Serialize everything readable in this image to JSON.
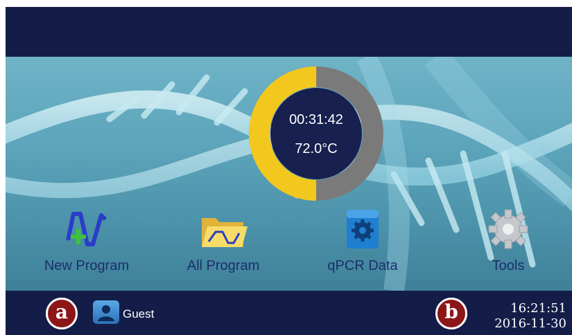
{
  "status": {
    "timer": "00:31:42",
    "temperature": "72.0°C",
    "progress_fraction": 0.5,
    "progress_color": "#f2c81e",
    "remaining_color": "#7a7a7a"
  },
  "apps": [
    {
      "label": "New Program",
      "icon": "new-program-icon"
    },
    {
      "label": "All Program",
      "icon": "folder-icon"
    },
    {
      "label": "qPCR Data",
      "icon": "data-gear-icon"
    },
    {
      "label": "Tools",
      "icon": "gear-icon"
    }
  ],
  "footer": {
    "marker_a": "a",
    "marker_b": "b",
    "user": "Guest",
    "time": "16:21:51",
    "date": "2016-11-30"
  },
  "colors": {
    "bar": "#141d48",
    "label_text": "#1b2f6b",
    "marker": "#8c1618"
  }
}
